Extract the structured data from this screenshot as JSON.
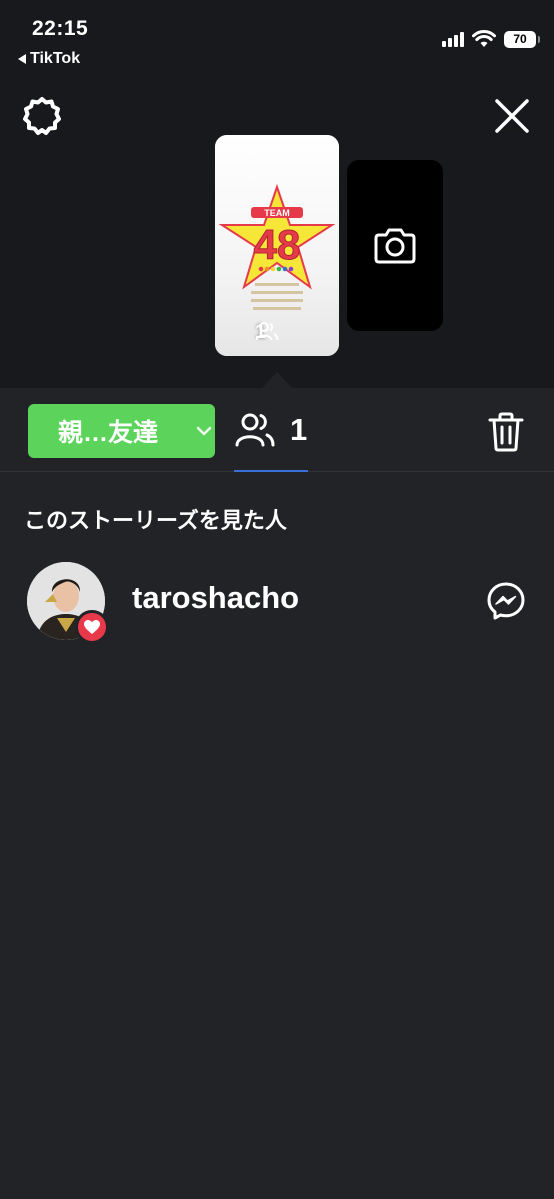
{
  "status_bar": {
    "time": "22:15",
    "back_app": "TikTok",
    "battery": "70"
  },
  "story": {
    "thumb_viewer_count": "1",
    "thumb_text": {
      "team": "TEAM",
      "number": "48"
    }
  },
  "toolbar": {
    "audience_label": "親…友達",
    "viewer_count": "1"
  },
  "section_title": "このストーリーズを見た人",
  "viewers": [
    {
      "username": "taroshacho",
      "reaction": "heart-icon"
    }
  ],
  "colors": {
    "audience_button": "#5cd45c",
    "heart_badge": "#e8394a",
    "tab_underline": "#3a6fd8"
  },
  "icons": [
    "settings-icon",
    "close-icon",
    "camera-icon",
    "viewers-icon",
    "trash-icon",
    "messenger-icon",
    "heart-icon"
  ]
}
